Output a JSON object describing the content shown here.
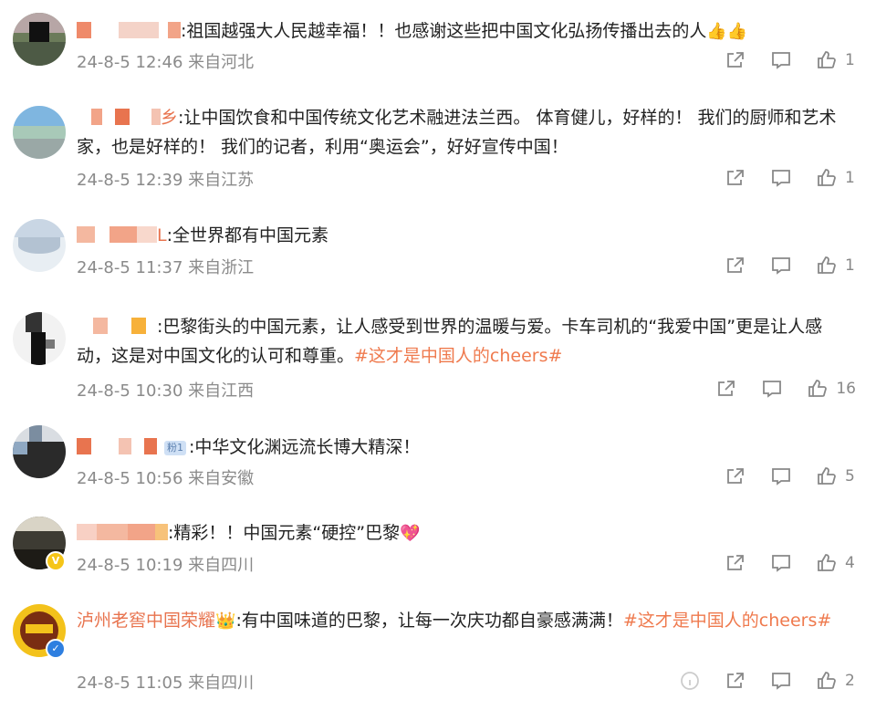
{
  "comments": [
    {
      "text": ":祖国越强大人民越幸福！！也感谢这些把中国文化弘扬传播出去的人",
      "emoji": "👍👍",
      "meta": "24-8-5 12:46 来自河北",
      "likes": "1"
    },
    {
      "name_suffix": "乡",
      "text": ":让中国饮食和中国传统文化艺术融进法兰西。 体育健儿，好样的！ 我们的厨师和艺术家，也是好样的！ 我们的记者，利用“奥运会”，好好宣传中国！",
      "meta": "24-8-5 12:39 来自江苏",
      "likes": "1"
    },
    {
      "name_suffix": "L",
      "text": ":全世界都有中国元素",
      "meta": "24-8-5 11:37 来自浙江",
      "likes": "1"
    },
    {
      "text": ":巴黎街头的中国元素，让人感受到世界的温暖与爱。卡车司机的“我爱中国”更是让人感动，这是对中国文化的认可和尊重。",
      "hashtag": "#这才是中国人的cheers#",
      "meta": "24-8-5 10:30 来自江西",
      "likes": "16"
    },
    {
      "badge": "粉1",
      "text": ":中华文化渊远流长博大精深！",
      "meta": "24-8-5 10:56 来自安徽",
      "likes": "5"
    },
    {
      "text": ":精彩！！中国元素“硬控”巴黎",
      "emoji": "💖",
      "meta": "24-8-5 10:19 来自四川",
      "likes": "4"
    },
    {
      "name": "泸州老窖中国荣耀",
      "name_emoji": "👑",
      "text": ":有中国味道的巴黎，让每一次庆功都自豪感满满！",
      "hashtag": "#这才是中国人的cheers#",
      "meta": "24-8-5 11:05 来自四川",
      "likes": "2"
    }
  ],
  "colors": {
    "name": "#e8744f",
    "hashtag": "#ef7a4e",
    "meta": "#8a8a8a",
    "icon": "#888888"
  },
  "icons": {
    "share": "share-icon",
    "comment": "comment-icon",
    "like": "thumbs-up-icon"
  }
}
